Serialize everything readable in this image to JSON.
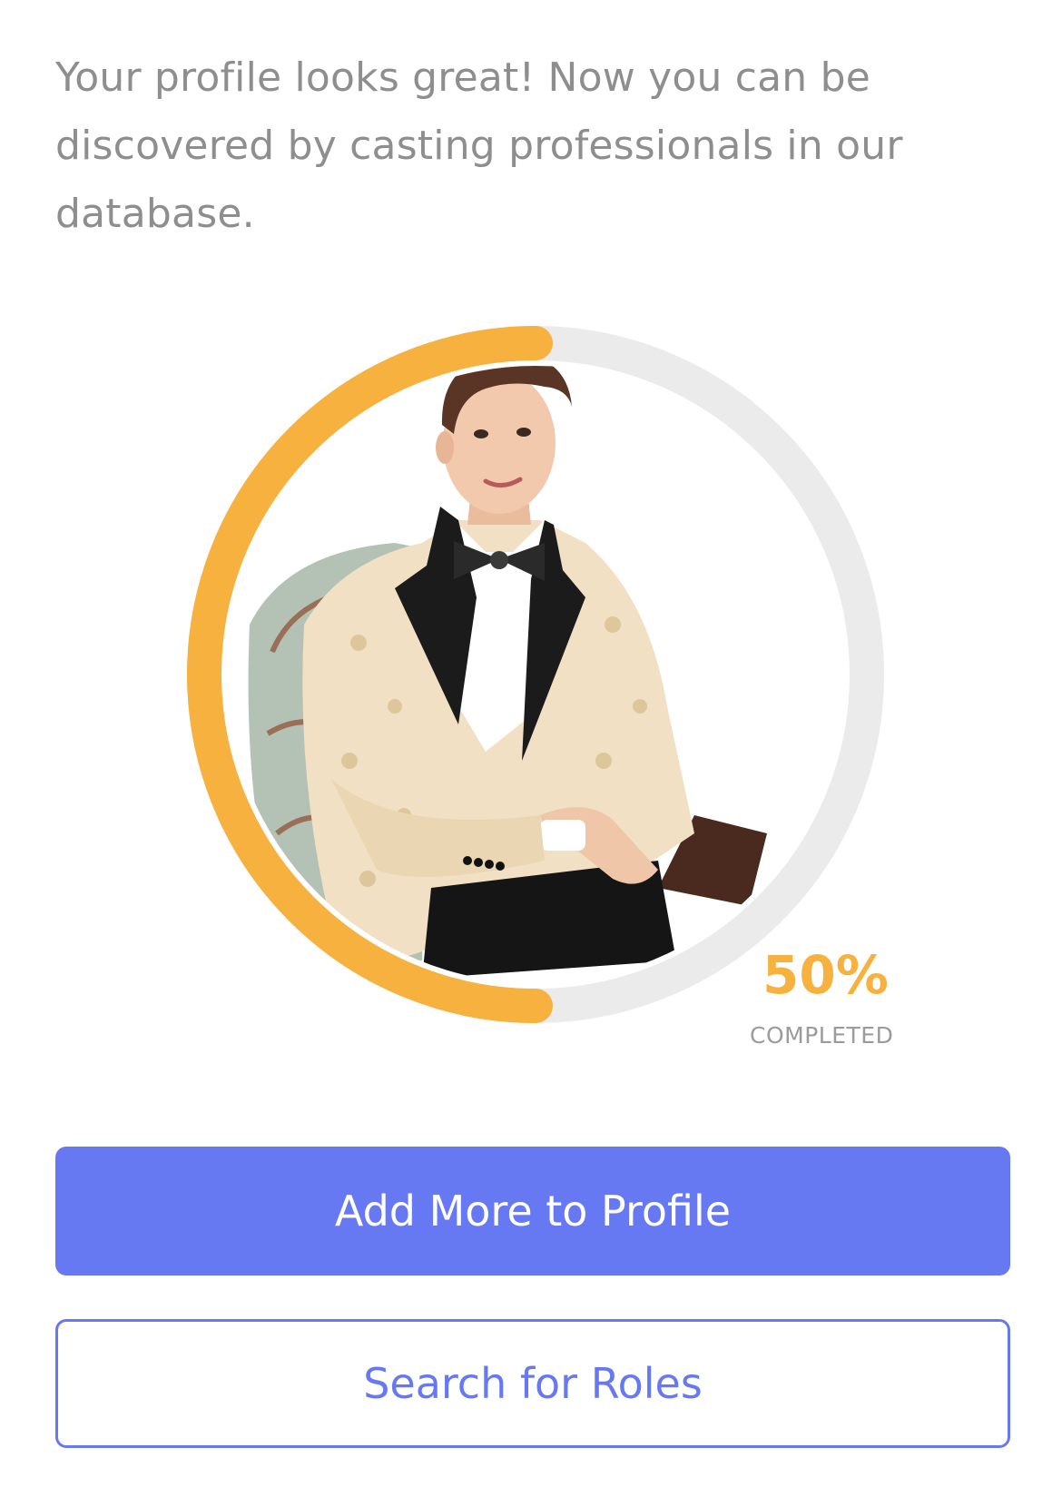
{
  "intro": {
    "text": "Your profile looks great! Now you can be discovered by casting professionals in our database."
  },
  "progress": {
    "value": 0.5,
    "percent_label": "50%",
    "status_label": "COMPLETED",
    "colors": {
      "fill": "#f7b13f",
      "track": "#ebebeb"
    }
  },
  "avatar": {
    "icon": "profile-photo"
  },
  "buttons": {
    "primary_label": "Add More to Profile",
    "secondary_label": "Search for Roles",
    "accent": "#6779f2"
  }
}
